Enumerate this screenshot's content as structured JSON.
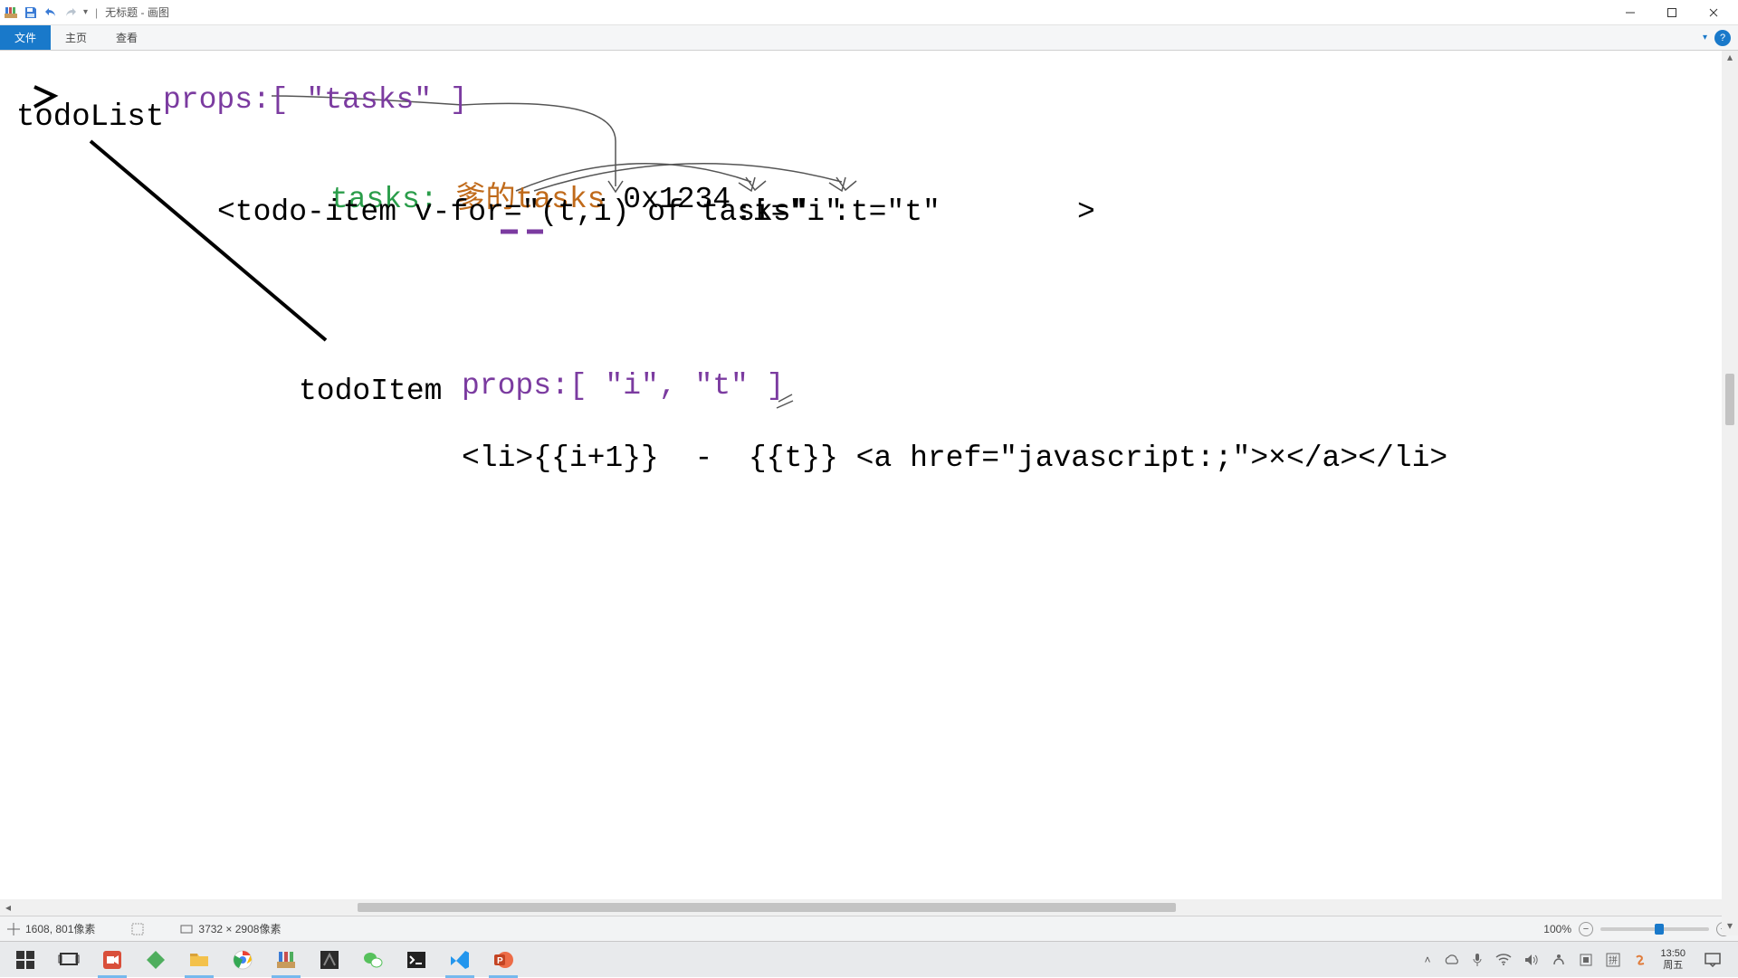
{
  "titlebar": {
    "title": "无标题 - 画图"
  },
  "menu": {
    "file": "文件",
    "home": "主页",
    "view": "查看"
  },
  "canvas": {
    "todoList": "todoList",
    "props_tasks": "props:[ \"tasks\" ]",
    "tasks_label": "tasks:",
    "tasks_orange": " 爹的tasks",
    "address": " 0x1234",
    "vfor_line": "<todo-item v-for=\"(t,i) of tasks\"",
    "bind_i": ":i=\"i\"",
    "bind_t": ":t=\"t\"",
    "close_angle": ">",
    "todoItem": "todoItem",
    "props_it": "props:[ \"i\", \"t\" ]",
    "li_line": "<li>{{i+1}}  -  {{t}} <a href=\"javascript:;\">×</a></li>"
  },
  "status": {
    "cursor": "1608, 801像素",
    "dims": "3732 × 2908像素",
    "zoom": "100%"
  },
  "clock": {
    "time": "13:50",
    "date": "周五"
  }
}
